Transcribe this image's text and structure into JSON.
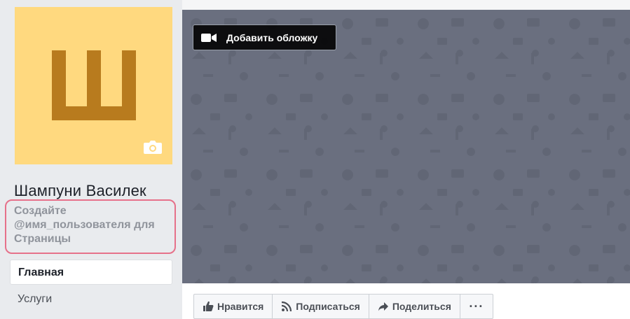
{
  "profile": {
    "avatar_letter": "Ш",
    "avatar_bg": "#ffd97f",
    "avatar_letter_color": "#b87b1e",
    "camera_icon": "camera-icon",
    "page_name": "Шампуни Василек",
    "username_prompt_line1": "Создайте",
    "username_prompt_line2": "@имя_пользователя для",
    "username_prompt_line3": "Страницы",
    "highlight_color": "#e6718a"
  },
  "nav": {
    "items": [
      {
        "label": "Главная",
        "active": true
      },
      {
        "label": "Услуги",
        "active": false
      }
    ]
  },
  "cover": {
    "add_cover_label": "Добавить обложку",
    "add_cover_icon": "video-camera-icon",
    "bg_color": "#6a6f7f"
  },
  "actions": {
    "like_label": "Нравится",
    "like_icon": "thumbs-up-icon",
    "follow_label": "Подписаться",
    "follow_icon": "rss-icon",
    "share_label": "Поделиться",
    "share_icon": "share-arrow-icon",
    "more_label": "···"
  }
}
